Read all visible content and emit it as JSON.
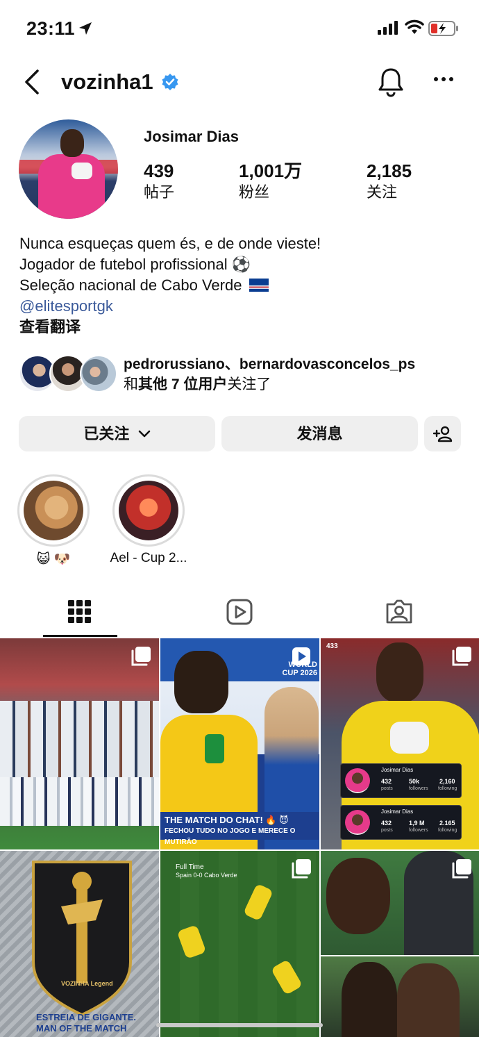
{
  "status_bar": {
    "time": "23:11"
  },
  "header": {
    "username": "vozinha1"
  },
  "profile": {
    "display_name": "Josimar Dias",
    "stats": [
      {
        "value": "439",
        "label": "帖子"
      },
      {
        "value": "1,001万",
        "label": "粉丝"
      },
      {
        "value": "2,185",
        "label": "关注"
      }
    ],
    "bio": {
      "line1": "Nunca esqueças quem és, e de onde vieste!",
      "line2": "Jogador de futebol profissional ⚽",
      "line3": "Seleção nacional de Cabo Verde",
      "link": "@elitesportgk",
      "translate": "查看翻译"
    },
    "mutual": {
      "names": "pedrorussiano、bernardovasconcelos_ps",
      "prefix": "和",
      "bold": "其他 7 位用户",
      "suffix": "关注了"
    }
  },
  "actions": {
    "follow_label": "已关注",
    "message_label": "发消息"
  },
  "highlights": [
    {
      "label": "😺 🐶"
    },
    {
      "label": "Ael - Cup 2..."
    }
  ],
  "tabs": [
    "posts-grid",
    "reels",
    "tagged"
  ],
  "posts": {
    "p2_brand": "WORLD CUP 2026",
    "p2_caption1": "THE MATCH DO CHAT! 🔥 😈",
    "p2_caption2": "FECHOU TUDO NO JOGO E MERECE O MUTIRÃO",
    "p3_name": "Josimar Dias",
    "p3_row1": [
      "432",
      "50k",
      "2,160"
    ],
    "p3_row2": [
      "432",
      "1,9 M",
      "2.165"
    ],
    "p3_labels": [
      "posts",
      "followers",
      "following"
    ],
    "p4_title1": "ESTREIA DE GIGANTE.",
    "p4_title2": "MAN OF THE MATCH",
    "p4_logo": "VOZINHA Legend",
    "p5_title": "Full Time",
    "p5_score": "Spain 0-0 Cabo Verde",
    "p6_tag": "433"
  },
  "colors": {
    "link": "#3b5a9a",
    "verified": "#3797f0",
    "button_bg": "#efefef"
  }
}
